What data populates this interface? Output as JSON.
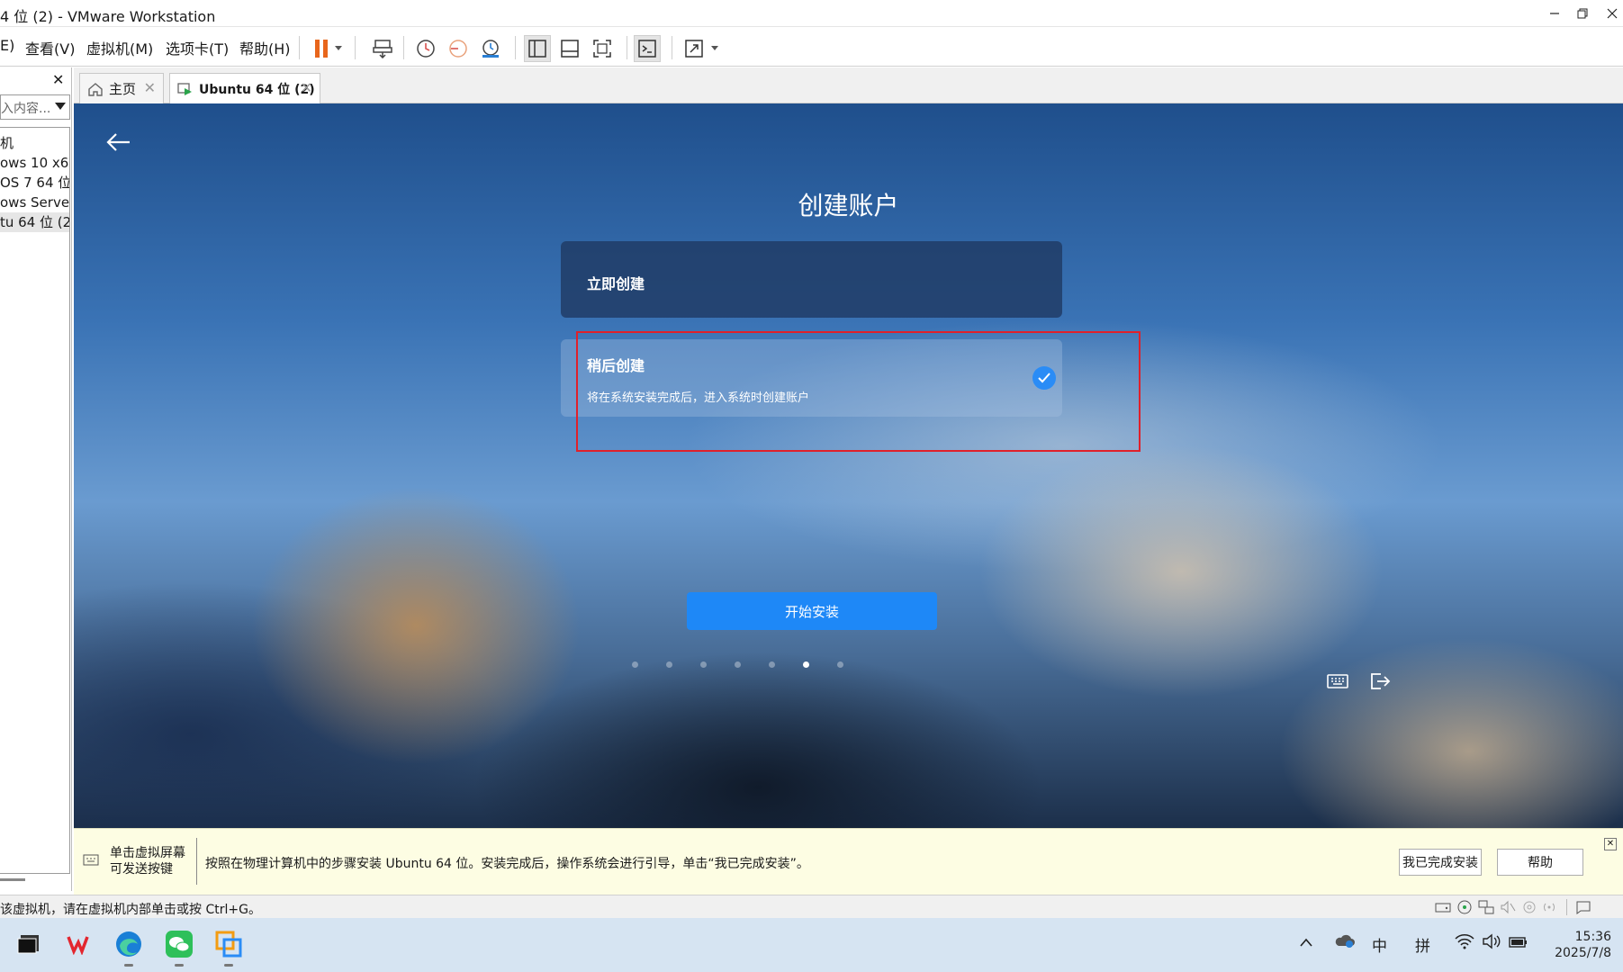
{
  "window": {
    "title": "4 位 (2) - VMware Workstation"
  },
  "menu": [
    "E)",
    "查看(V)",
    "虚拟机(M)",
    "选项卡(T)",
    "帮助(H)"
  ],
  "library": {
    "search_placeholder": "入内容...",
    "items": [
      "机",
      "ows 10 x64",
      "OS 7 64 位",
      "ows Server",
      "tu 64 位 (2)"
    ]
  },
  "tabs": [
    {
      "label": "主页",
      "active": false
    },
    {
      "label": "Ubuntu 64 位 (2)",
      "active": true
    }
  ],
  "vm_screen": {
    "title": "创建账户",
    "option_now": {
      "label": "立即创建"
    },
    "option_later": {
      "label": "稍后创建",
      "desc": "将在系统安装完成后，进入系统时创建账户",
      "selected": true
    },
    "install_button": "开始安装",
    "progress_dots": {
      "count": 7,
      "active_index": 5
    },
    "accent_color": "#1e88f7",
    "highlight_color": "#e0202a"
  },
  "hint_bar": {
    "left_text_line1": "单击虚拟屏幕",
    "left_text_line2": "可发送按键",
    "message": "按照在物理计算机中的步骤安装 Ubuntu 64 位。安装完成后，操作系统会进行引导，单击“我已完成安装”。",
    "done_button": "我已完成安装",
    "help_button": "帮助"
  },
  "status_bar": {
    "text": "该虚拟机，请在虚拟机内部单击或按 Ctrl+G。"
  },
  "taskbar": {
    "ime_lang": "中",
    "ime_mode": "拼",
    "time": "15:36",
    "date": "2025/7/8"
  }
}
